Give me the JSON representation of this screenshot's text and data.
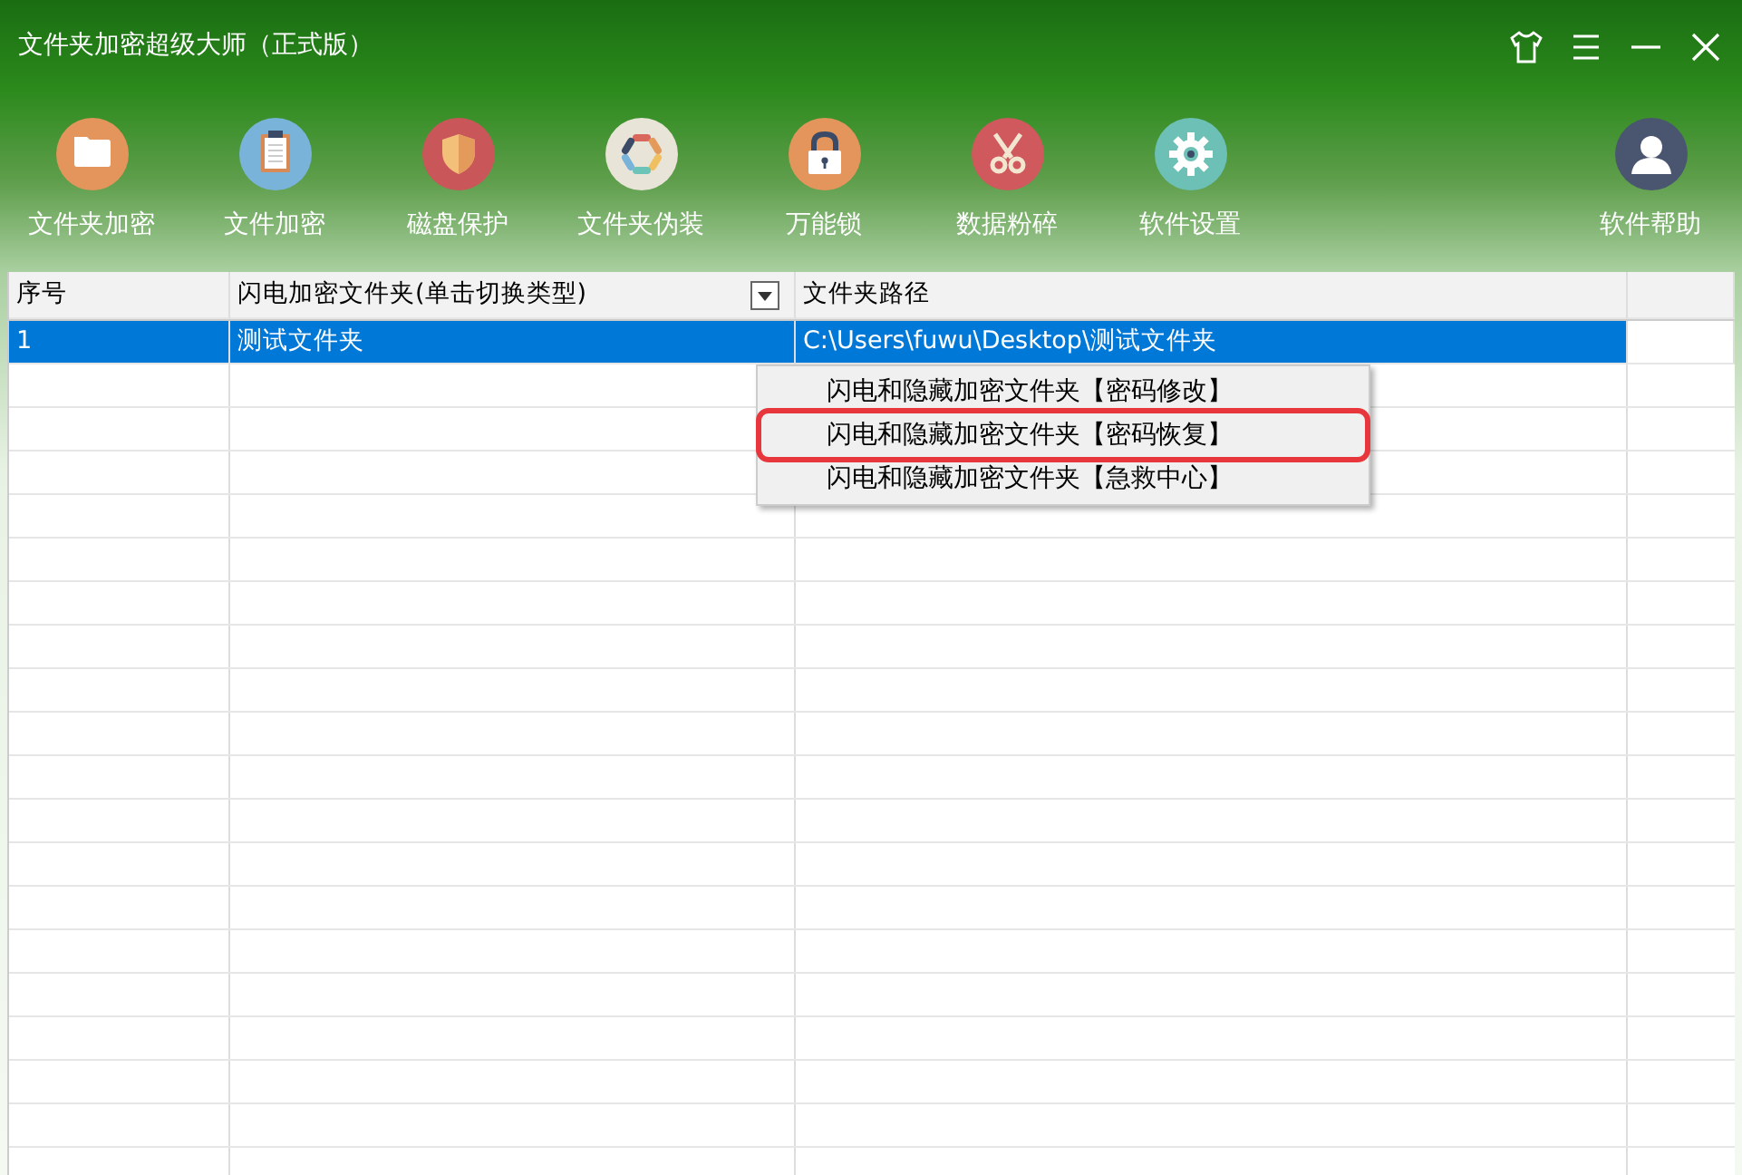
{
  "window": {
    "title": "文件夹加密超级大师（正式版）"
  },
  "toolbar": [
    {
      "label": "文件夹加密",
      "kind": "folder"
    },
    {
      "label": "文件加密",
      "kind": "clipboard"
    },
    {
      "label": "磁盘保护",
      "kind": "shield"
    },
    {
      "label": "文件夹伪装",
      "kind": "palette"
    },
    {
      "label": "万能锁",
      "kind": "lock"
    },
    {
      "label": "数据粉碎",
      "kind": "scissors"
    },
    {
      "label": "软件设置",
      "kind": "gear"
    },
    {
      "label": "软件帮助",
      "kind": "user"
    }
  ],
  "table": {
    "columns": [
      "序号",
      "闪电加密文件夹(单击切换类型)",
      "文件夹路径"
    ],
    "rows": [
      {
        "cells": [
          "1",
          "测试文件夹",
          "C:\\Users\\fuwu\\Desktop\\测试文件夹"
        ],
        "selected": true
      }
    ]
  },
  "context_menu": {
    "items": [
      {
        "label": "闪电和隐藏加密文件夹【密码修改】",
        "selected": false
      },
      {
        "label": "闪电和隐藏加密文件夹【密码恢复】",
        "selected": true
      },
      {
        "label": "闪电和隐藏加密文件夹【急救中心】",
        "selected": false
      }
    ]
  }
}
